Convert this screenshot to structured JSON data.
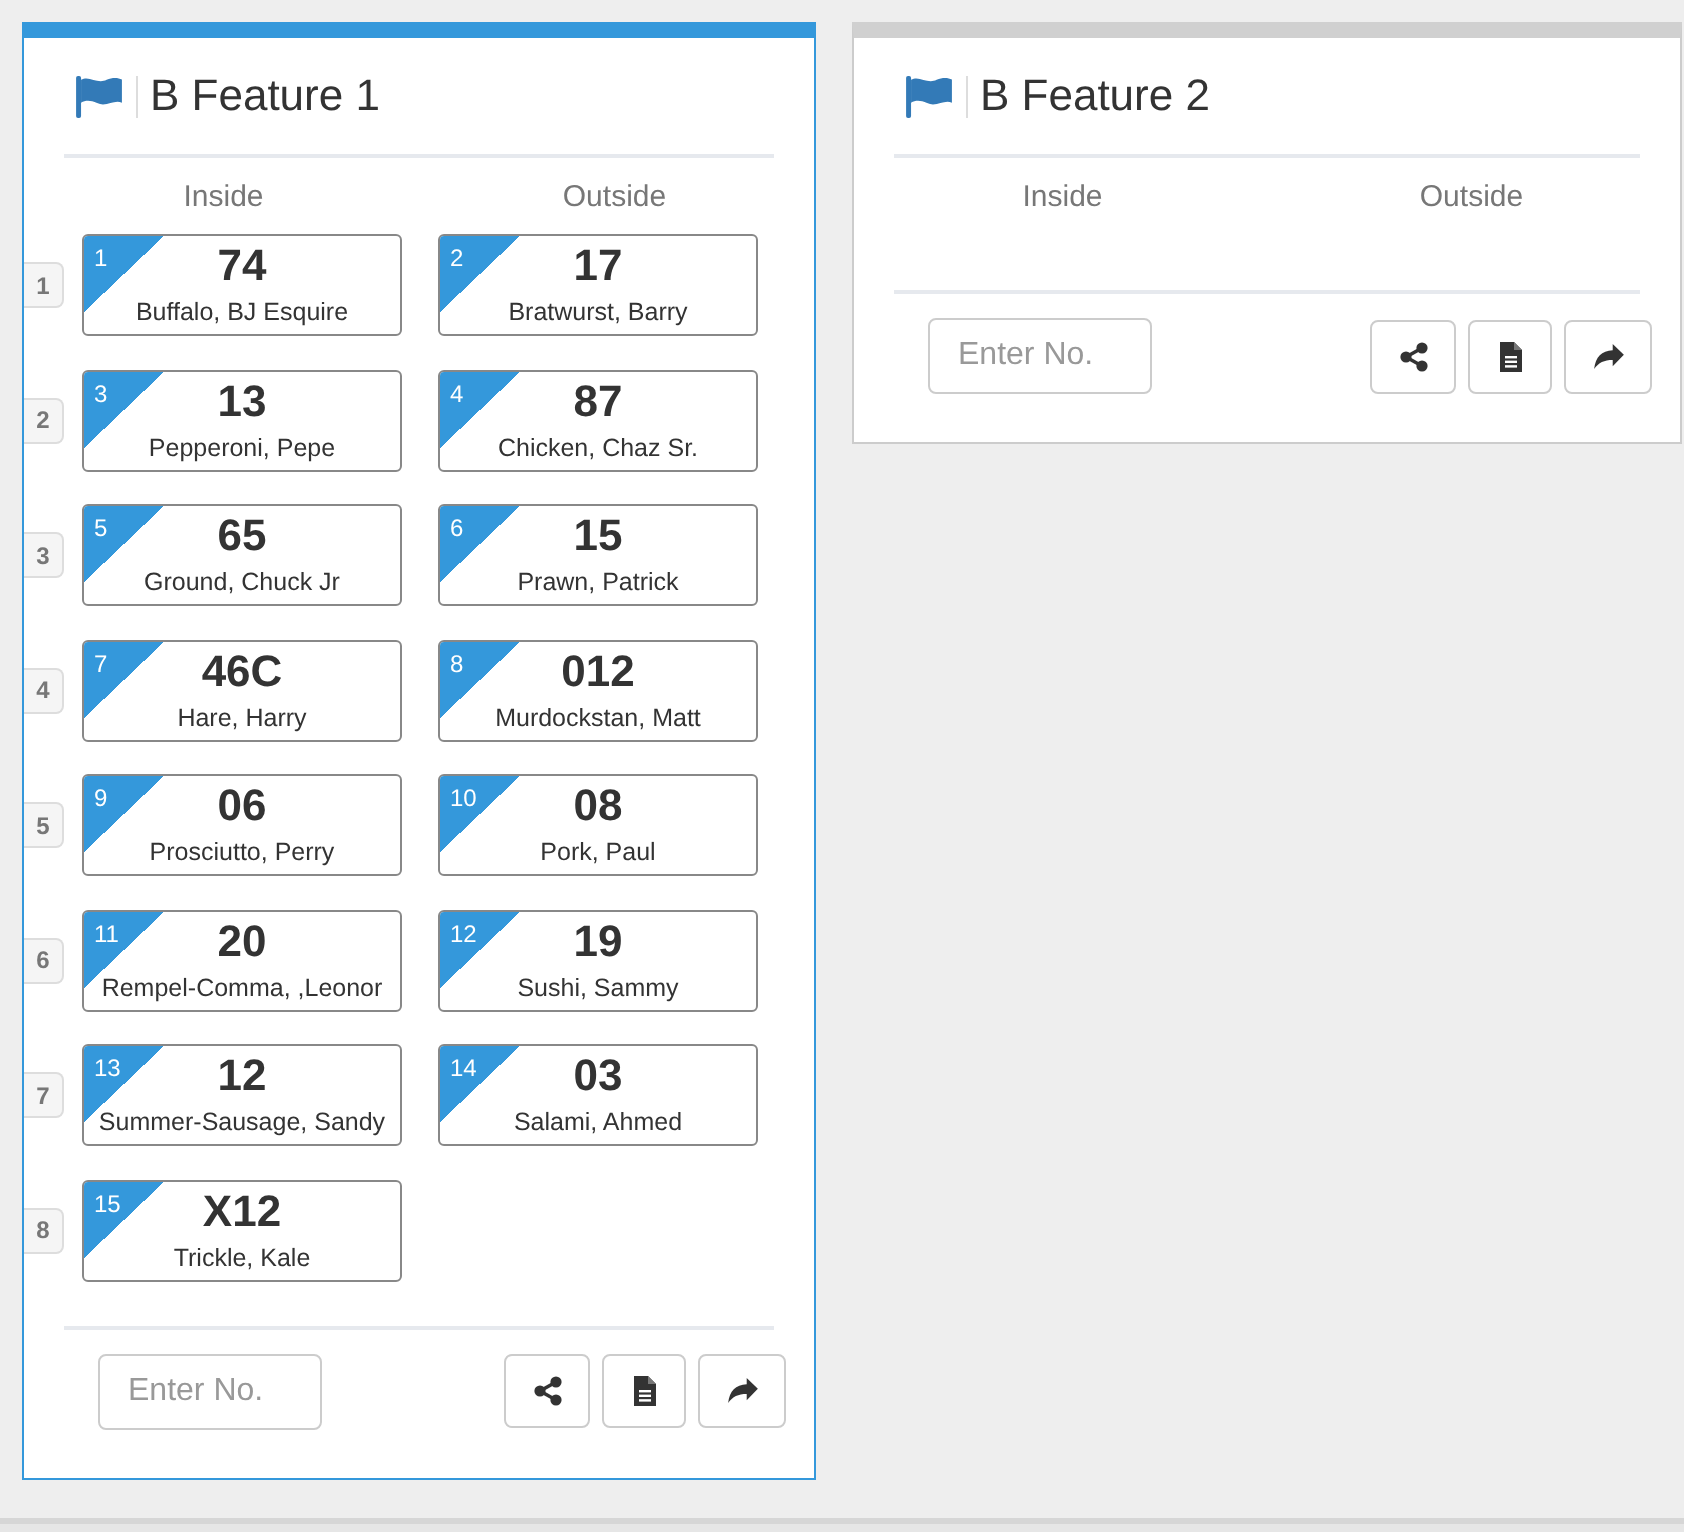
{
  "panels": [
    {
      "title": "B Feature 1",
      "selected": true,
      "columns": [
        "Inside",
        "Outside"
      ],
      "rows": [
        {
          "label": "1",
          "cards": [
            {
              "badge": "1",
              "number": "74",
              "name": "Buffalo, BJ Esquire"
            },
            {
              "badge": "2",
              "number": "17",
              "name": "Bratwurst, Barry"
            }
          ]
        },
        {
          "label": "2",
          "cards": [
            {
              "badge": "3",
              "number": "13",
              "name": "Pepperoni, Pepe"
            },
            {
              "badge": "4",
              "number": "87",
              "name": "Chicken, Chaz Sr."
            }
          ]
        },
        {
          "label": "3",
          "cards": [
            {
              "badge": "5",
              "number": "65",
              "name": "Ground, Chuck Jr"
            },
            {
              "badge": "6",
              "number": "15",
              "name": "Prawn, Patrick"
            }
          ]
        },
        {
          "label": "4",
          "cards": [
            {
              "badge": "7",
              "number": "46C",
              "name": "Hare, Harry"
            },
            {
              "badge": "8",
              "number": "012",
              "name": "Murdockstan, Matt"
            }
          ]
        },
        {
          "label": "5",
          "cards": [
            {
              "badge": "9",
              "number": "06",
              "name": "Prosciutto, Perry"
            },
            {
              "badge": "10",
              "number": "08",
              "name": "Pork, Paul"
            }
          ]
        },
        {
          "label": "6",
          "cards": [
            {
              "badge": "11",
              "number": "20",
              "name": "Rempel-Comma, ,Leonor"
            },
            {
              "badge": "12",
              "number": "19",
              "name": "Sushi, Sammy"
            }
          ]
        },
        {
          "label": "7",
          "cards": [
            {
              "badge": "13",
              "number": "12",
              "name": "Summer-Sausage, Sandy"
            },
            {
              "badge": "14",
              "number": "03",
              "name": "Salami, Ahmed"
            }
          ]
        },
        {
          "label": "8",
          "cards": [
            {
              "badge": "15",
              "number": "X12",
              "name": "Trickle, Kale"
            }
          ]
        }
      ],
      "entry": {
        "placeholder": "Enter No."
      },
      "actions": [
        {
          "kind": "share"
        },
        {
          "kind": "document"
        },
        {
          "kind": "forward"
        }
      ]
    },
    {
      "title": "B Feature 2",
      "selected": false,
      "columns": [
        "Inside",
        "Outside"
      ],
      "entry": {
        "placeholder": "Enter No."
      },
      "actions": [
        {
          "kind": "share"
        },
        {
          "kind": "document"
        },
        {
          "kind": "forward"
        }
      ]
    }
  ]
}
